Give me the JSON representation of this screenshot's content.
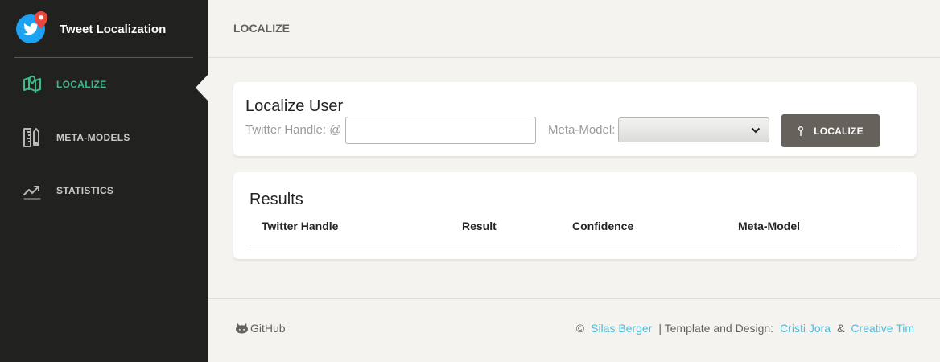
{
  "app": {
    "title": "Tweet Localization",
    "logo_icon": "twitter-bird-icon",
    "accent": "#3cba8a",
    "brand_color": "#1da1f2"
  },
  "sidebar": {
    "items": [
      {
        "label": "LOCALIZE",
        "icon": "map-pin-icon",
        "active": true
      },
      {
        "label": "META-MODELS",
        "icon": "pencil-ruler-icon",
        "active": false
      },
      {
        "label": "STATISTICS",
        "icon": "trending-up-icon",
        "active": false
      }
    ]
  },
  "header": {
    "title": "LOCALIZE"
  },
  "localize_card": {
    "title": "Localize User",
    "handle_label": "Twitter Handle: @",
    "handle_value": "",
    "meta_label": "Meta-Model:",
    "meta_selected": "",
    "button_label": "LOCALIZE",
    "button_color": "#66615b"
  },
  "results_card": {
    "title": "Results",
    "columns": [
      "Twitter Handle",
      "Result",
      "Confidence",
      "Meta-Model"
    ]
  },
  "footer": {
    "github_label": "GitHub",
    "copyright_symbol": "©",
    "author": "Silas Berger",
    "template_text": "| Template and Design:",
    "designer1": "Cristi Jora",
    "ampersand": "&",
    "designer2": "Creative Tim",
    "link_color": "#51bcda"
  }
}
